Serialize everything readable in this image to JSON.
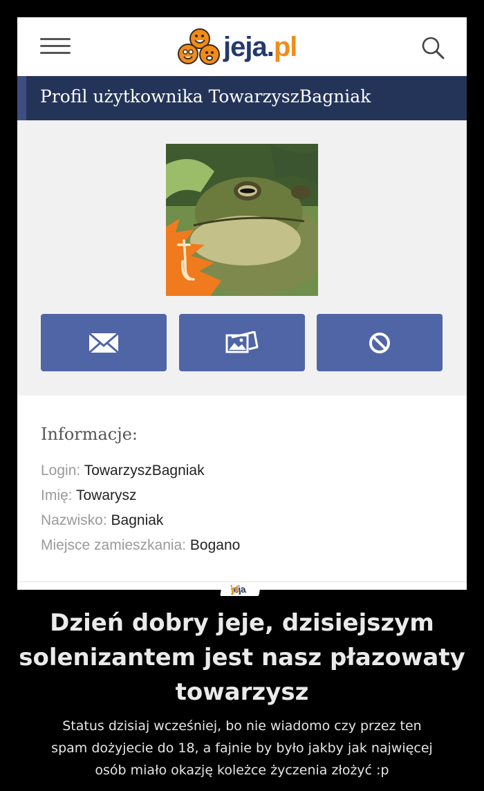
{
  "header": {
    "logo_jeja": "jeja",
    "logo_dot": ".",
    "logo_pl": "pl"
  },
  "profile": {
    "title": "Profil użytkownika TowarzyszBagniak",
    "avatar": "frog-avatar",
    "buttons": [
      {
        "icon": "envelope-icon"
      },
      {
        "icon": "image-icon"
      },
      {
        "icon": "block-icon"
      }
    ],
    "colors": {
      "title_bar": "#243459",
      "button": "#4f65a6",
      "logo_blue": "#243a6b",
      "logo_orange": "#f08c1a"
    }
  },
  "info": {
    "heading": "Informacje:",
    "rows": [
      {
        "label": "Login:",
        "value": "TowarzyszBagniak"
      },
      {
        "label": "Imię:",
        "value": "Towarysz"
      },
      {
        "label": "Nazwisko:",
        "value": "Bagniak"
      },
      {
        "label": "Miejsce zamieszkania:",
        "value": "Bogano"
      }
    ]
  },
  "footer": {
    "logo_jeja": "jeja",
    "logo_dot": ".",
    "logo_pl": "pl"
  },
  "caption": {
    "headline_lines": [
      "Dzień dobry jeje, dzisiejszym",
      "solenizantem jest nasz płazowaty",
      "towarzysz"
    ],
    "subtext_lines": [
      "Status dzisiaj wcześniej, bo nie wiadomo czy przez ten",
      "spam dożyjecie do 18, a fajnie by było jakby jak najwięcej",
      "osób miało okazję koleżce życzenia złożyć :p"
    ]
  }
}
